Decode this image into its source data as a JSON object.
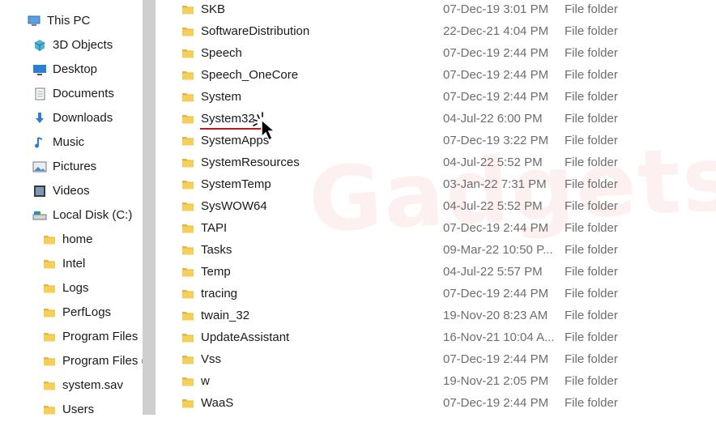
{
  "nav": {
    "items": [
      {
        "label": "This PC",
        "icon": "pc-icon",
        "level": 0
      },
      {
        "label": "3D Objects",
        "icon": "cube-icon",
        "level": 1
      },
      {
        "label": "Desktop",
        "icon": "desktop-icon",
        "level": 1
      },
      {
        "label": "Documents",
        "icon": "documents-icon",
        "level": 1
      },
      {
        "label": "Downloads",
        "icon": "download-icon",
        "level": 1
      },
      {
        "label": "Music",
        "icon": "music-icon",
        "level": 1
      },
      {
        "label": "Pictures",
        "icon": "pictures-icon",
        "level": 1
      },
      {
        "label": "Videos",
        "icon": "videos-icon",
        "level": 1
      },
      {
        "label": "Local Disk (C:)",
        "icon": "drive-icon",
        "level": 1
      },
      {
        "label": "home",
        "icon": "folder-icon",
        "level": 2
      },
      {
        "label": "Intel",
        "icon": "folder-icon",
        "level": 2
      },
      {
        "label": "Logs",
        "icon": "folder-icon",
        "level": 2
      },
      {
        "label": "PerfLogs",
        "icon": "folder-icon",
        "level": 2
      },
      {
        "label": "Program Files",
        "icon": "folder-icon",
        "level": 2
      },
      {
        "label": "Program Files (",
        "icon": "folder-icon",
        "level": 2
      },
      {
        "label": "system.sav",
        "icon": "folder-icon",
        "level": 2
      },
      {
        "label": "Users",
        "icon": "folder-icon",
        "level": 2
      }
    ]
  },
  "files": [
    {
      "name": "SKB",
      "date": "07-Dec-19 3:01 PM",
      "type": "File folder"
    },
    {
      "name": "SoftwareDistribution",
      "date": "22-Dec-21 4:04 PM",
      "type": "File folder"
    },
    {
      "name": "Speech",
      "date": "07-Dec-19 2:44 PM",
      "type": "File folder"
    },
    {
      "name": "Speech_OneCore",
      "date": "07-Dec-19 2:44 PM",
      "type": "File folder"
    },
    {
      "name": "System",
      "date": "07-Dec-19 2:44 PM",
      "type": "File folder"
    },
    {
      "name": "System32",
      "date": "04-Jul-22 6:00 PM",
      "type": "File folder",
      "highlighted": true
    },
    {
      "name": "SystemApps",
      "date": "07-Dec-19 3:22 PM",
      "type": "File folder"
    },
    {
      "name": "SystemResources",
      "date": "04-Jul-22 5:52 PM",
      "type": "File folder"
    },
    {
      "name": "SystemTemp",
      "date": "03-Jan-22 7:31 PM",
      "type": "File folder"
    },
    {
      "name": "SysWOW64",
      "date": "04-Jul-22 5:52 PM",
      "type": "File folder"
    },
    {
      "name": "TAPI",
      "date": "07-Dec-19 2:44 PM",
      "type": "File folder"
    },
    {
      "name": "Tasks",
      "date": "09-Mar-22 10:50 P...",
      "type": "File folder"
    },
    {
      "name": "Temp",
      "date": "04-Jul-22 5:57 PM",
      "type": "File folder"
    },
    {
      "name": "tracing",
      "date": "07-Dec-19 2:44 PM",
      "type": "File folder"
    },
    {
      "name": "twain_32",
      "date": "19-Nov-20 8:23 AM",
      "type": "File folder"
    },
    {
      "name": "UpdateAssistant",
      "date": "16-Nov-21 10:04 A...",
      "type": "File folder"
    },
    {
      "name": "Vss",
      "date": "07-Dec-19 2:44 PM",
      "type": "File folder"
    },
    {
      "name": "w",
      "date": "19-Nov-21 2:05 PM",
      "type": "File folder"
    },
    {
      "name": "WaaS",
      "date": "07-Dec-19 2:44 PM",
      "type": "File folder"
    }
  ],
  "watermark": "Gadgets",
  "colors": {
    "folder": "#f2c94c",
    "folder_dark": "#d9a520",
    "accent_underline": "#b81c1c"
  }
}
